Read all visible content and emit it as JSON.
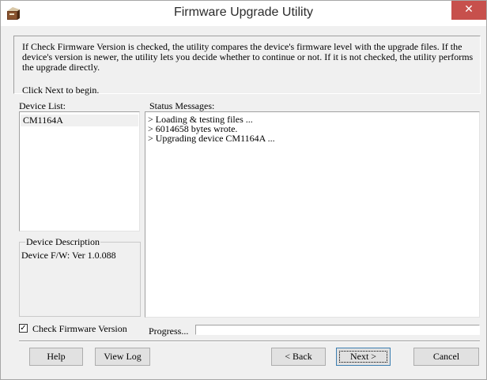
{
  "window": {
    "title": "Firmware Upgrade Utility",
    "close_glyph": "✕",
    "app_icon": "upgrade-app-icon",
    "close_color": "#c7504c"
  },
  "info": {
    "paragraph": "If Check Firmware Version is checked, the utility compares the device's firmware level with the upgrade files. If the device's version is newer, the utility lets you decide whether to continue or not. If it is not checked, the utility performs the upgrade directly.",
    "line2": "Click Next to begin."
  },
  "device_list": {
    "label": "Device List:",
    "items": [
      "CM1164A"
    ]
  },
  "status": {
    "label": "Status Messages:",
    "lines": [
      "> Loading & testing files ...",
      "> 6014658 bytes wrote.",
      "> Upgrading device CM1164A ..."
    ]
  },
  "description": {
    "group_title": "Device Description",
    "value": "Device F/W: Ver 1.0.088"
  },
  "check_firmware": {
    "label": "Check Firmware Version",
    "checked": true,
    "glyph": "✓"
  },
  "progress": {
    "label": "Progress...",
    "value": 0
  },
  "buttons": {
    "help": "Help",
    "view_log": "View Log",
    "back": "< Back",
    "next": "Next >",
    "cancel": "Cancel"
  }
}
